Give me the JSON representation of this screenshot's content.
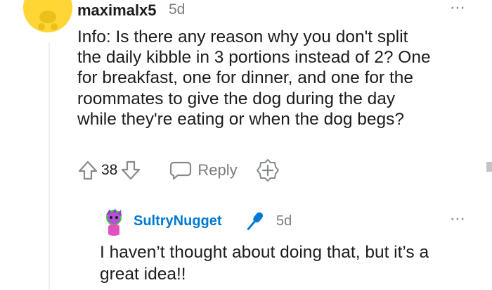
{
  "comment": {
    "author": "maximalx5",
    "time": "5d",
    "more_icon": "⋯",
    "body": "Info: Is there any reason why you don't split\nthe daily kibble in 3 portions instead of 2? One\nfor breakfast, one for dinner, and one for the\nroommates to give the dog during the day\nwhile they're eating or when the dog begs?",
    "votes": "38",
    "reply_label": "Reply",
    "avatar_color": "#ffd635"
  },
  "reply": {
    "author": "SultryNugget",
    "time": "5d",
    "more_icon": "⋯",
    "body": "I haven’t thought about doing that, but it’s a\ngreat idea!!",
    "author_color": "#0079d3",
    "flair_color": "#0079d3"
  },
  "icons": {
    "upvote": "arrow-up-icon",
    "downvote": "arrow-down-icon",
    "reply": "speech-bubble-icon",
    "award": "award-plus-icon",
    "flair": "microphone-icon",
    "more": "more-dots-icon"
  }
}
